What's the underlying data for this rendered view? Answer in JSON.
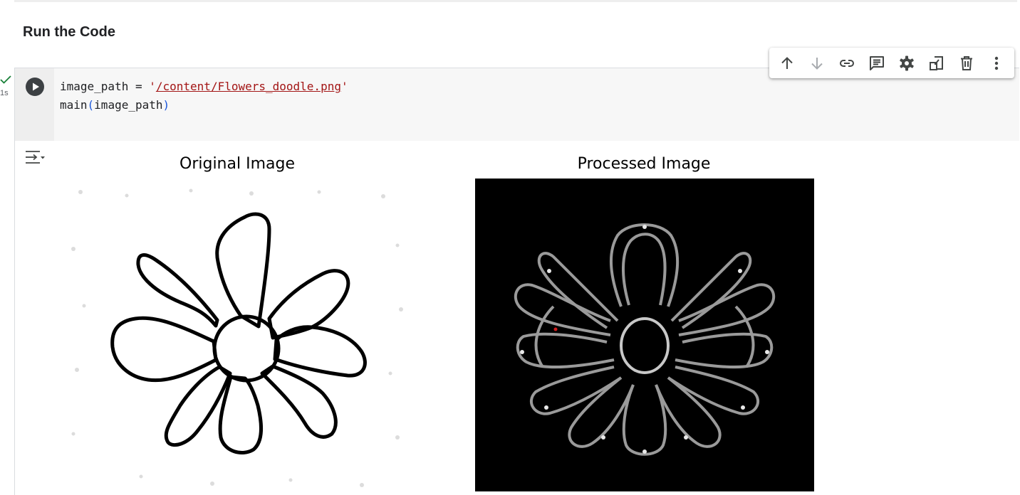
{
  "section": {
    "heading": "Run the Code"
  },
  "cell": {
    "status": {
      "icon": "check-icon",
      "exec_time": "1s"
    },
    "code": {
      "line1_var": "image_path = ",
      "line1_quote_open": "'",
      "line1_path": "/content/Flowers_doodle.png",
      "line1_quote_close": "'",
      "line2_fn": "main",
      "line2_open": "(",
      "line2_arg": "image_path",
      "line2_close": ")"
    },
    "toolbar": [
      {
        "icon": "arrow-up-icon",
        "label": "Move cell up"
      },
      {
        "icon": "arrow-down-icon",
        "label": "Move cell down"
      },
      {
        "icon": "link-icon",
        "label": "Copy link to cell"
      },
      {
        "icon": "comment-icon",
        "label": "Add a comment"
      },
      {
        "icon": "gear-icon",
        "label": "Open editor settings"
      },
      {
        "icon": "mirror-cell-icon",
        "label": "Mirror cell in tab"
      },
      {
        "icon": "trash-icon",
        "label": "Delete cell"
      },
      {
        "icon": "more-vert-icon",
        "label": "More cell actions"
      }
    ]
  },
  "output": {
    "left_title": "Original Image",
    "right_title": "Processed Image"
  },
  "colors": {
    "string": "#a31515",
    "paren": "#1a56db",
    "success": "#188038",
    "icon": "#444746"
  }
}
